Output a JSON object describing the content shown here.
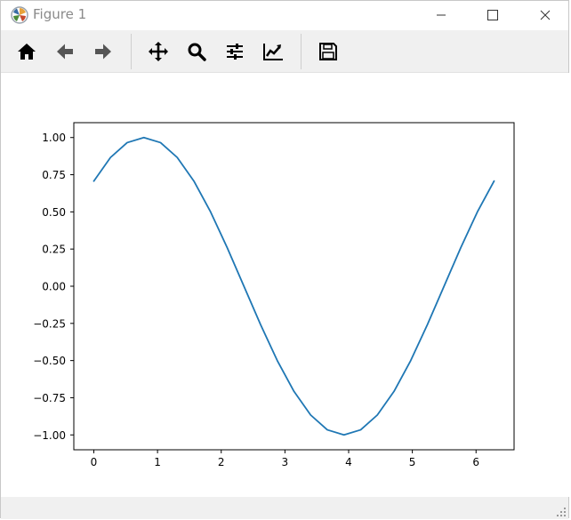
{
  "window": {
    "title": "Figure 1",
    "controls": [
      "minimize",
      "maximize",
      "close"
    ]
  },
  "toolbar": {
    "buttons": [
      {
        "id": "home",
        "icon": "home-icon"
      },
      {
        "id": "back",
        "icon": "arrow-left-icon"
      },
      {
        "id": "forward",
        "icon": "arrow-right-icon"
      },
      {
        "id": "pan",
        "icon": "move-icon"
      },
      {
        "id": "zoom",
        "icon": "magnifier-icon"
      },
      {
        "id": "configure",
        "icon": "sliders-icon"
      },
      {
        "id": "edit-axes",
        "icon": "line-chart-icon"
      },
      {
        "id": "save",
        "icon": "floppy-icon"
      }
    ]
  },
  "statusbar": {
    "message": ""
  },
  "chart_data": {
    "type": "line",
    "title": "",
    "xlabel": "",
    "ylabel": "",
    "xlim": [
      -0.314,
      6.597
    ],
    "ylim": [
      -1.1,
      1.1
    ],
    "xticks": [
      0,
      1,
      2,
      3,
      4,
      5,
      6
    ],
    "xtick_labels": [
      "0",
      "1",
      "2",
      "3",
      "4",
      "5",
      "6"
    ],
    "yticks": [
      1.0,
      0.75,
      0.5,
      0.25,
      0.0,
      -0.25,
      -0.5,
      -0.75,
      -1.0
    ],
    "ytick_labels": [
      "1.00",
      "0.75",
      "0.50",
      "0.25",
      "0.00",
      "−0.25",
      "−0.50",
      "−0.75",
      "−1.00"
    ],
    "grid": false,
    "legend": false,
    "series": [
      {
        "color": "#1f77b4",
        "x": [
          0,
          0.2618,
          0.5236,
          0.7854,
          1.0472,
          1.309,
          1.5708,
          1.8326,
          2.0944,
          2.3562,
          2.618,
          2.8798,
          3.1416,
          3.4034,
          3.6652,
          3.927,
          4.1888,
          4.4506,
          4.7124,
          4.9742,
          5.236,
          5.4978,
          5.7596,
          6.0214,
          6.2832
        ],
        "y": [
          0.7071,
          0.866,
          0.9659,
          1.0,
          0.9659,
          0.866,
          0.7071,
          0.5,
          0.2588,
          0.0,
          -0.2588,
          -0.5,
          -0.7071,
          -0.866,
          -0.9659,
          -1.0,
          -0.9659,
          -0.866,
          -0.7071,
          -0.5,
          -0.2588,
          0.0,
          0.2588,
          0.5,
          0.7071
        ]
      }
    ]
  }
}
